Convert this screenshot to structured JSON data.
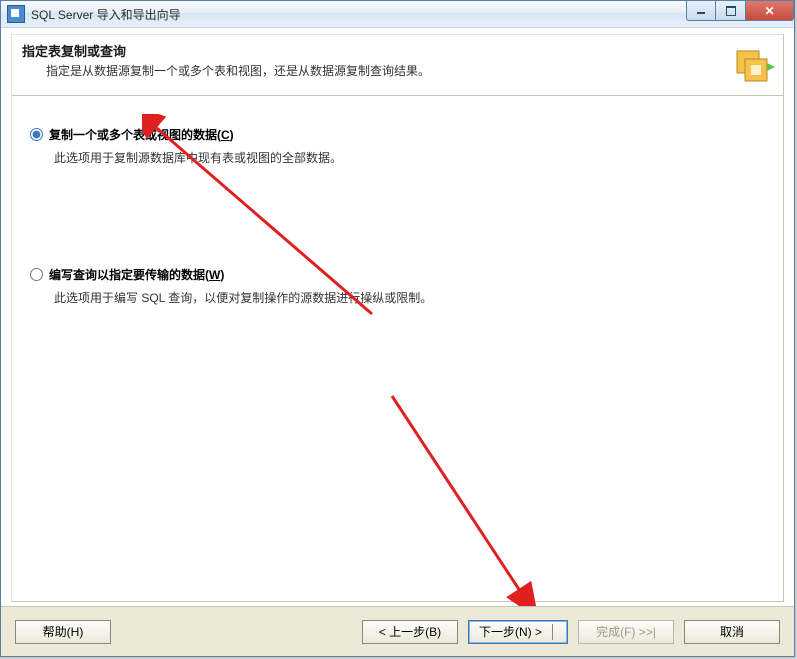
{
  "window": {
    "title": "SQL Server 导入和导出向导"
  },
  "header": {
    "title": "指定表复制或查询",
    "desc": "指定是从数据源复制一个或多个表和视图，还是从数据源复制查询结果。"
  },
  "options": {
    "copy": {
      "label_prefix": "复制一个或多个表或视图的数据(",
      "hotkey": "C",
      "label_suffix": ")",
      "desc": "此选项用于复制源数据库中现有表或视图的全部数据。",
      "selected": true
    },
    "query": {
      "label_prefix": "编写查询以指定要传输的数据(",
      "hotkey": "W",
      "label_suffix": ")",
      "desc": "此选项用于编写 SQL 查询，以便对复制操作的源数据进行操纵或限制。",
      "selected": false
    }
  },
  "footer": {
    "help": "帮助(H)",
    "back": "< 上一步(B)",
    "next": "下一步(N) >",
    "finish": "完成(F) >>|",
    "cancel": "取消"
  }
}
